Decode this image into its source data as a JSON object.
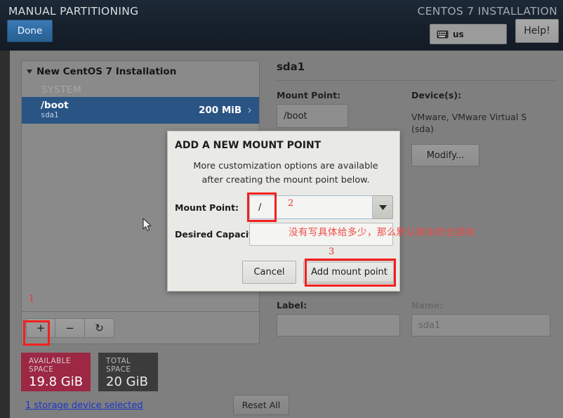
{
  "header": {
    "title": "MANUAL PARTITIONING",
    "product": "CENTOS 7 INSTALLATION",
    "done_label": "Done",
    "keyboard_layout": "us",
    "help_label": "Help!"
  },
  "partition_list": {
    "group_title": "New CentOS 7 Installation",
    "section_label": "SYSTEM",
    "rows": [
      {
        "mount": "/boot",
        "device": "sda1",
        "size": "200 MiB",
        "chevron": "›"
      }
    ]
  },
  "toolbar": {
    "add_label": "+",
    "remove_label": "−",
    "refresh_label": "↻"
  },
  "space": {
    "available_caption": "AVAILABLE SPACE",
    "available_value": "19.8 GiB",
    "total_caption": "TOTAL SPACE",
    "total_value": "20 GiB",
    "available_color": "#9c2843",
    "total_color": "#3b3b3b",
    "device_link": "1 storage device selected"
  },
  "detail": {
    "title": "sda1",
    "mount_point_label": "Mount Point:",
    "mount_point_value": "/boot",
    "devices_label": "Device(s):",
    "devices_value": "VMware, VMware Virtual S (sda)",
    "modify_label": "Modify...",
    "label_label": "Label:",
    "label_value": "",
    "name_label": "Name:",
    "name_value": "sda1"
  },
  "reset": {
    "label": "Reset All"
  },
  "modal": {
    "title": "ADD A NEW MOUNT POINT",
    "subtitle": "More customization options are available after creating the mount point below.",
    "mount_point_label": "Mount Point:",
    "mount_point_value": "/",
    "desired_capacity_label": "Desired Capacity:",
    "desired_capacity_value": "",
    "cancel_label": "Cancel",
    "add_label": "Add mount point"
  },
  "annotations": {
    "marker_1": "1",
    "marker_2": "2",
    "marker_3": "3",
    "note_cn": "没有写具体给多少，那么默认剩余的全部给",
    "color": "#f3201e"
  }
}
